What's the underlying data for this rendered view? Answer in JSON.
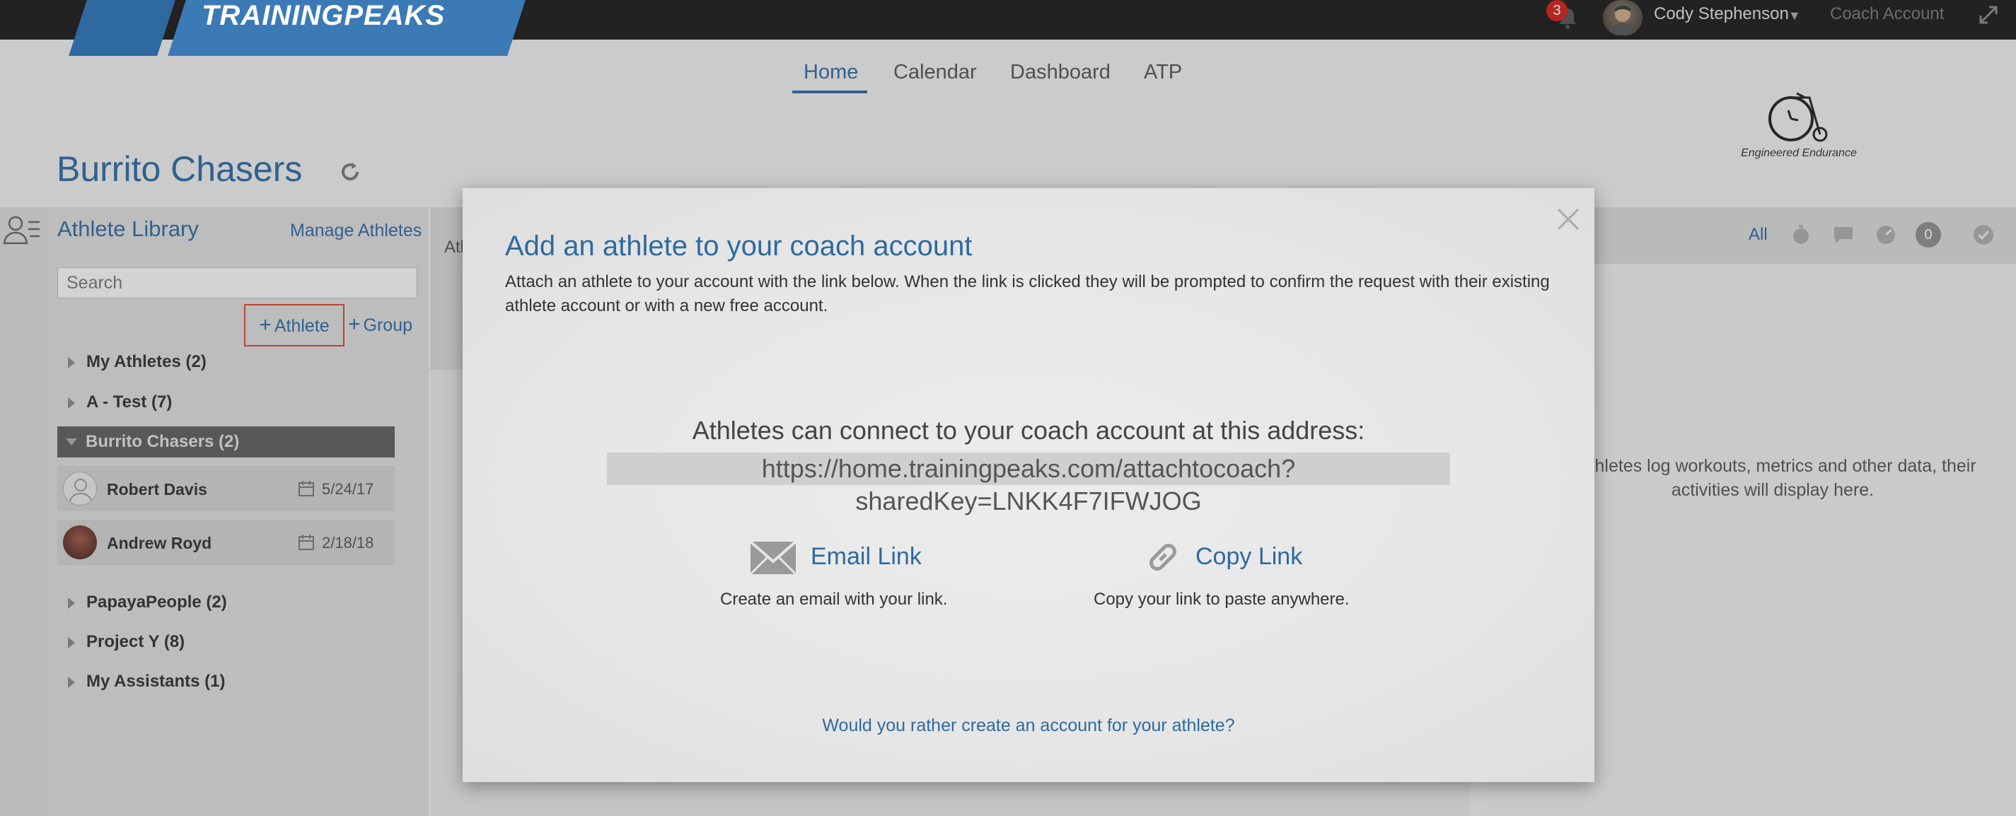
{
  "brand": {
    "logo_text": "TRAININGPEAKS"
  },
  "topbar": {
    "notification_count": "3",
    "user_name": "Cody Stephenson",
    "coach_account_label": "Coach Account"
  },
  "nav": {
    "items": [
      {
        "label": "Home",
        "active": true
      },
      {
        "label": "Calendar",
        "active": false
      },
      {
        "label": "Dashboard",
        "active": false
      },
      {
        "label": "ATP",
        "active": false
      }
    ]
  },
  "team": {
    "logo_caption": "Engineered Endurance"
  },
  "page": {
    "title": "Burrito Chasers"
  },
  "sidebar": {
    "title": "Athlete Library",
    "manage_link": "Manage Athletes",
    "search_placeholder": "Search",
    "add_athlete_label": "Athlete",
    "add_group_label": "Group",
    "groups": [
      {
        "label": "My Athletes (2)"
      },
      {
        "label": "A - Test (7)"
      },
      {
        "label": "Burrito Chasers (2)",
        "expanded": true
      },
      {
        "label": "PapayaPeople (2)"
      },
      {
        "label": "Project Y (8)"
      },
      {
        "label": "My Assistants (1)"
      }
    ],
    "athletes": [
      {
        "name": "Robert Davis",
        "date": "5/24/17"
      },
      {
        "name": "Andrew Royd",
        "date": "2/18/18"
      }
    ]
  },
  "center": {
    "column_label": "Ath"
  },
  "activity": {
    "filter_all": "All",
    "count": "0",
    "empty_message": "r athletes log workouts, metrics and other data, their activities will display here."
  },
  "modal": {
    "title": "Add an athlete to your coach account",
    "description": "Attach an athlete to your account with the link below. When the link is clicked they will be prompted to confirm the request with their existing athlete account or with a new free account.",
    "connect_label": "Athletes can connect to your coach account at this address:",
    "share_url": "https://home.trainingpeaks.com/attachtocoach?sharedKey=LNKK4F7IFWJOG",
    "email_link": "Email Link",
    "email_sub": "Create an email with your link.",
    "copy_link": "Copy Link",
    "copy_sub": "Copy your link to paste anywhere.",
    "rather_link": "Would you rather create an account for your athlete?"
  },
  "colors": {
    "brand_blue": "#2e6aa0",
    "highlight_red": "#e0452f",
    "topbar": "#1d1d1d",
    "badge_red": "#d0211c"
  }
}
